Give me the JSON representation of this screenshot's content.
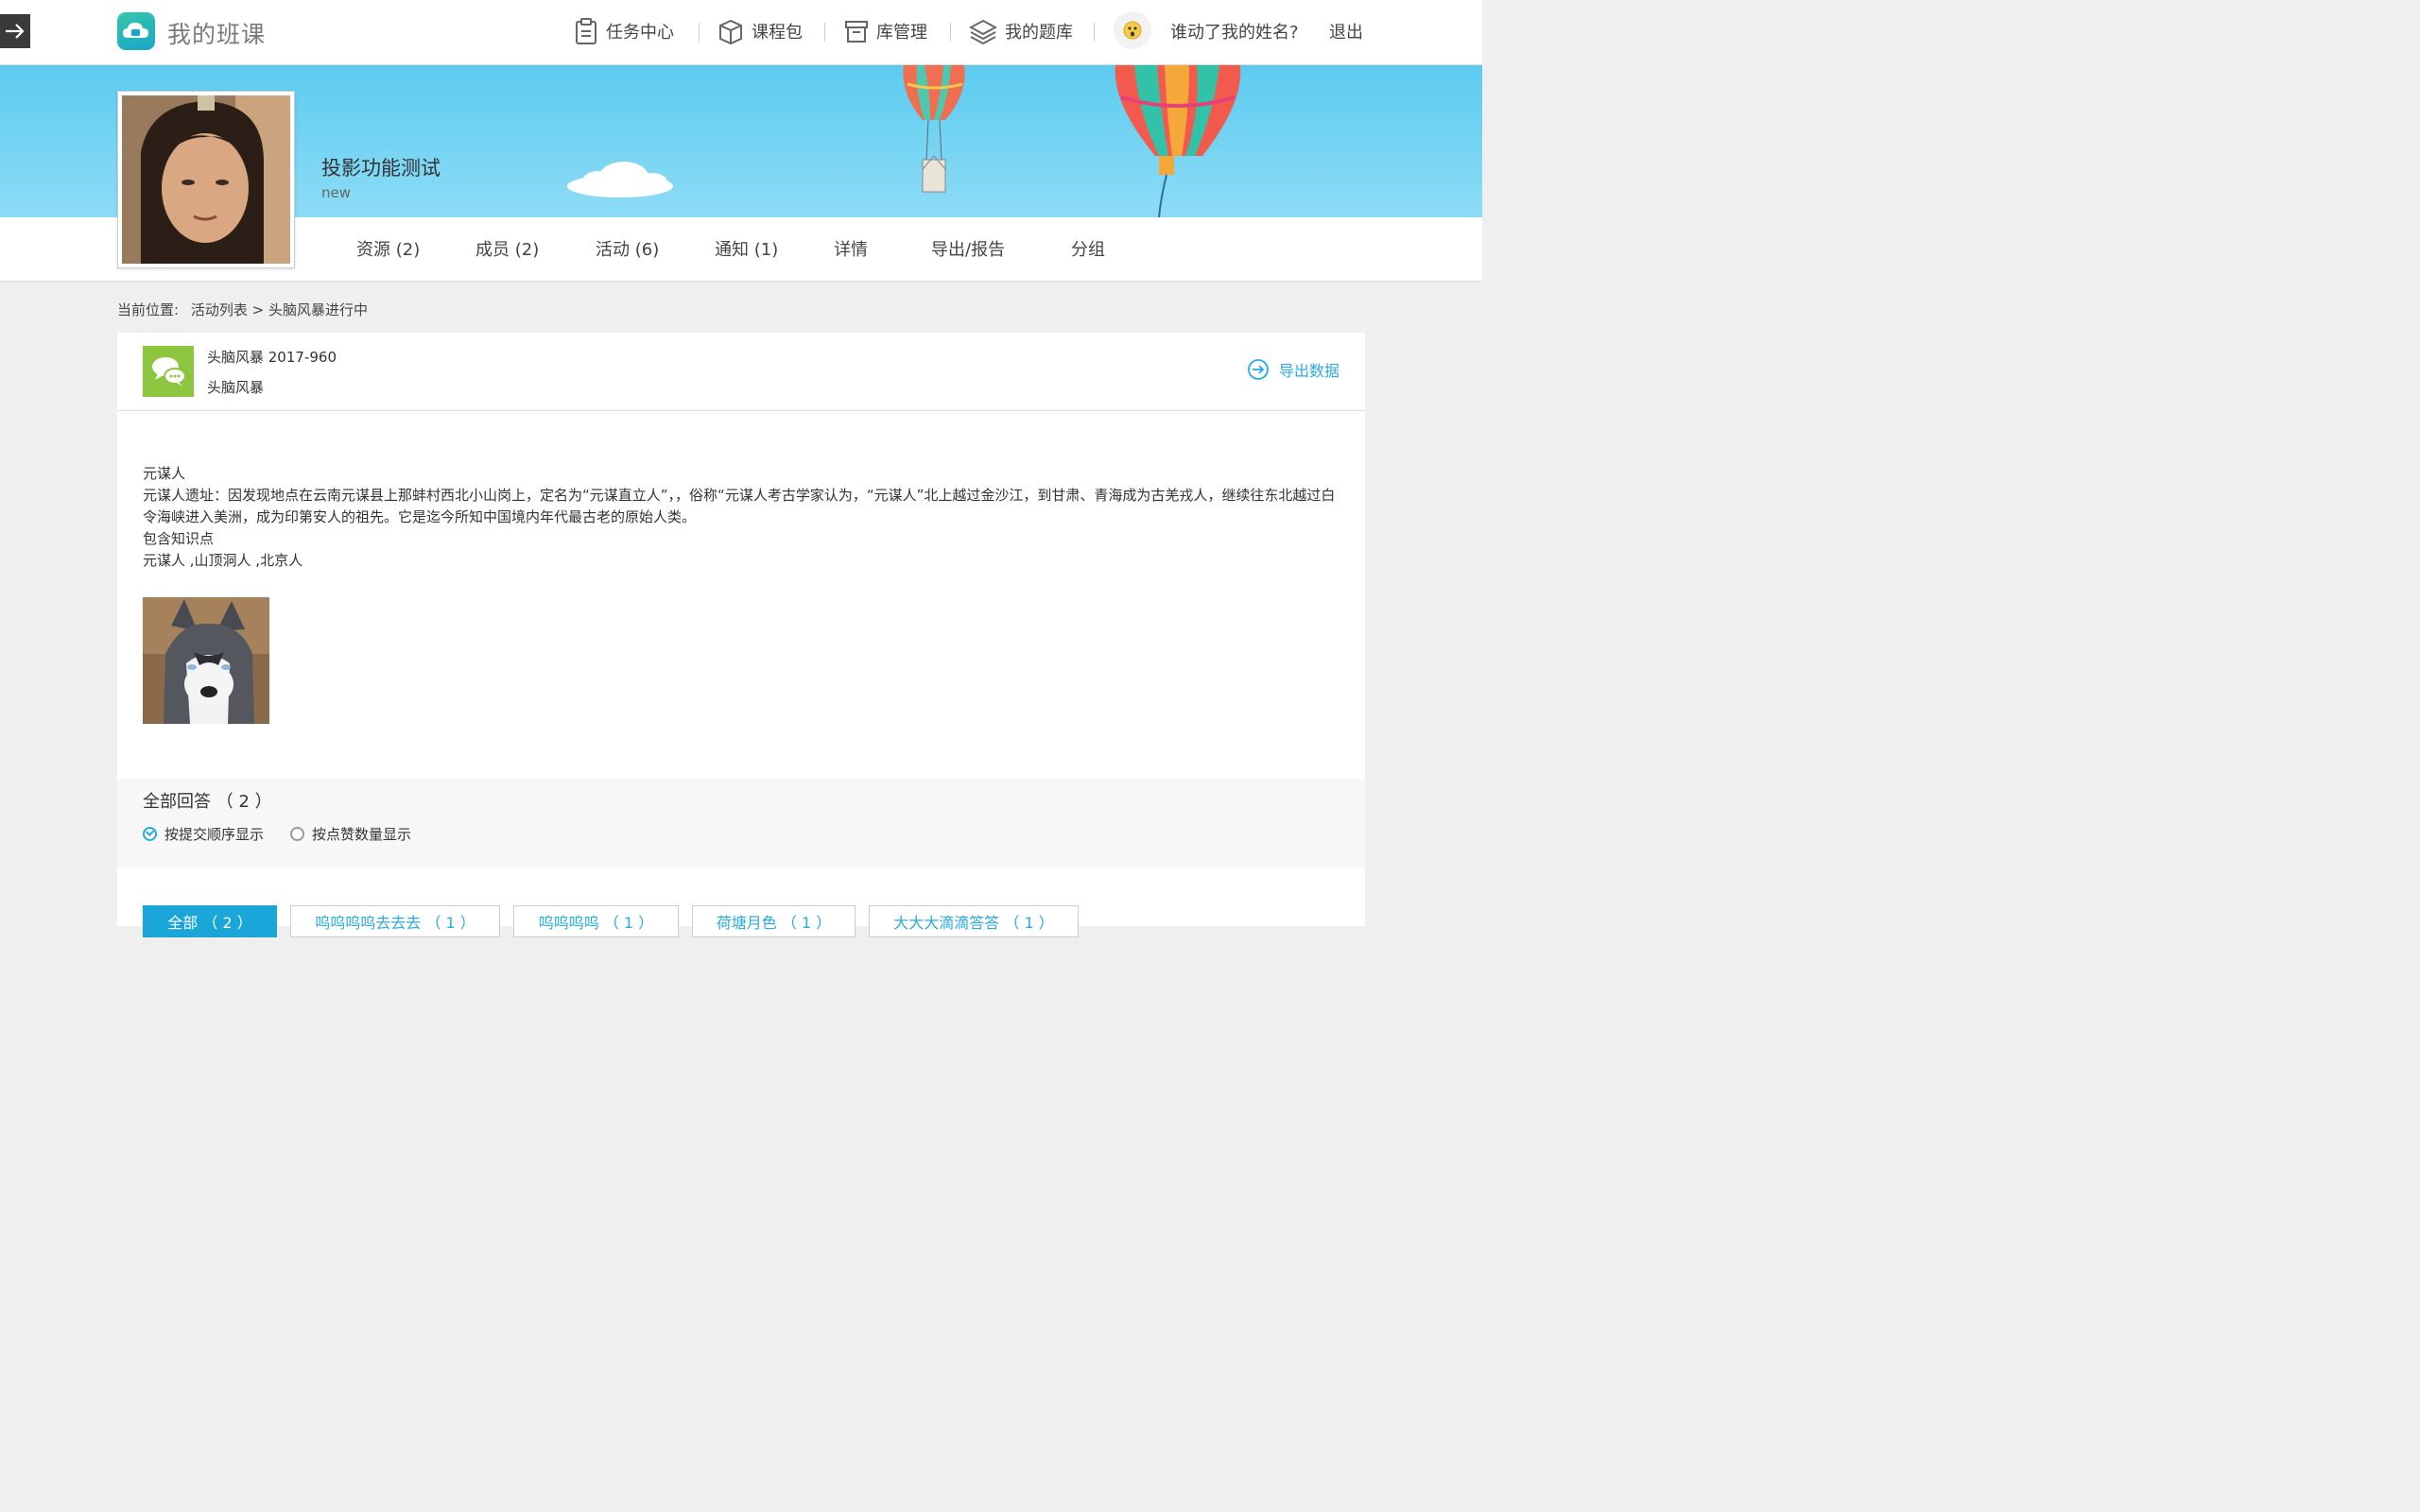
{
  "header": {
    "brand": "我的班课",
    "nav": [
      {
        "label": "任务中心",
        "icon": "clipboard-icon"
      },
      {
        "label": "课程包",
        "icon": "box-icon"
      },
      {
        "label": "库管理",
        "icon": "archive-icon"
      },
      {
        "label": "我的题库",
        "icon": "layers-icon"
      }
    ],
    "user_name": "谁动了我的姓名?",
    "logout": "退出"
  },
  "class_info": {
    "title": "投影功能测试",
    "subtitle": "new"
  },
  "tabs": [
    "资源 (2)",
    "成员 (2)",
    "活动 (6)",
    "通知 (1)",
    "详情",
    "导出/报告",
    "分组"
  ],
  "breadcrumb": {
    "prefix": "当前位置:",
    "link": "活动列表",
    "separator": ">",
    "current": "头脑风暴进行中"
  },
  "activity": {
    "name": "头脑风暴 2017-960",
    "type": "头脑风暴",
    "export_label": "导出数据",
    "content": [
      "元谋人",
      "元谋人遗址：因发现地点在云南元谋县上那蚌村西北小山岗上，定名为“元谋直立人”，，俗称“元谋人考古学家认为，“元谋人”北上越过金沙江，到甘肃、青海成为古羌戎人，继续往东北越过白令海峡进入美洲，成为印第安人的祖先。它是迄今所知中国境内年代最古老的原始人类。",
      "包含知识点",
      "元谋人 ,山顶洞人 ,北京人"
    ]
  },
  "answers": {
    "title": "全部回答 （ 2 ）",
    "sort_by_time": "按提交顺序显示",
    "sort_by_likes": "按点赞数量显示",
    "filters": [
      "全部 （ 2 ）",
      "呜呜呜呜去去去 （ 1 ）",
      "呜呜呜呜 （ 1 ）",
      "荷塘月色 （ 1 ）",
      "大大大滴滴答答 （ 1 ）"
    ]
  },
  "colors": {
    "accent": "#29abe2",
    "banner": "#5ccbef",
    "activity_icon": "#8cc63f"
  }
}
